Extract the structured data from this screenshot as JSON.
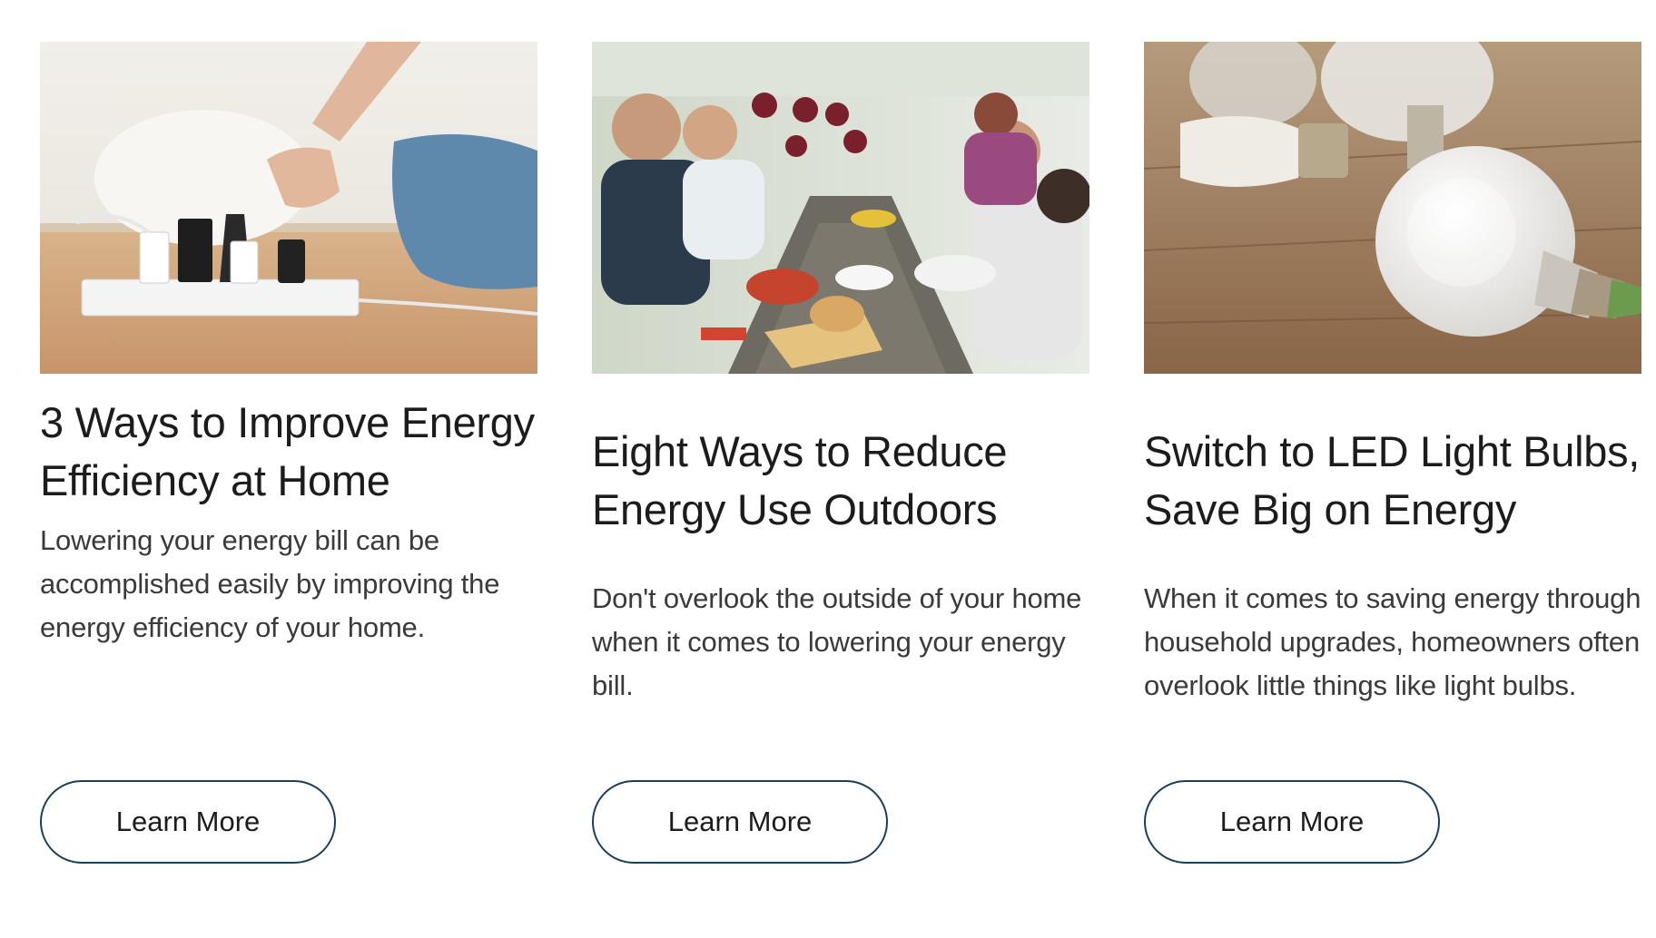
{
  "cards": [
    {
      "image_alt": "hand unplugging a cord from a power strip",
      "title": "3 Ways to Improve Energy Efficiency at Home",
      "description": "Lowering your energy bill can be accomplished easily by improving the energy efficiency of your home.",
      "button_label": "Learn More"
    },
    {
      "image_alt": "friends toasting with wine at an outdoor dinner table",
      "title": "Eight Ways to Reduce Energy Use Outdoors",
      "description": "Don't overlook the outside of your home when it comes to lowering your energy bill.",
      "button_label": "Learn More"
    },
    {
      "image_alt": "LED and incandescent light bulbs on a wooden table",
      "title": "Switch to LED Light Bulbs, Save Big on Energy",
      "description": "When it comes to saving energy through household upgrades, homeowners often overlook little things like light bulbs.",
      "button_label": "Learn More"
    }
  ],
  "colors": {
    "button_border": "#1b3f57",
    "title_text": "#1c1c1c",
    "body_text": "#3a3a3a"
  }
}
